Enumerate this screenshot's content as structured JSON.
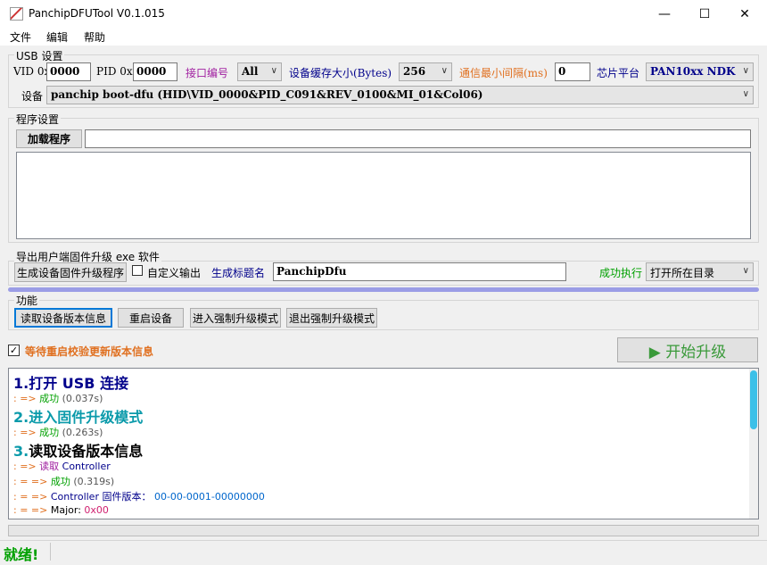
{
  "window": {
    "title": "PanchipDFUTool V0.1.015",
    "minimize": "—",
    "maximize": "☐",
    "close": "✕"
  },
  "menu": [
    "文件",
    "编辑",
    "帮助"
  ],
  "usb": {
    "group_label": "USB 设置",
    "vid_label": "VID 0x",
    "vid_value": "0000",
    "pid_label": "PID 0x",
    "pid_value": "0000",
    "port_label": "接口编号",
    "port_value": "All",
    "buffer_label": "设备缓存大小(Bytes)",
    "buffer_value": "256",
    "interval_label": "通信最小间隔(ms)",
    "interval_value": "0",
    "chip_label": "芯片平台",
    "chip_value": "PAN10xx NDK",
    "device_label": "设备",
    "device_value": "panchip boot-dfu (HID\\VID_0000&PID_C091&REV_0100&MI_01&Col06)"
  },
  "program": {
    "group_label": "程序设置",
    "load_button": "加载程序",
    "path_value": ""
  },
  "export": {
    "group_label": "导出用户端固件升级 exe 软件",
    "generate_button": "生成设备固件升级程序",
    "custom_output_label": "自定义输出",
    "title_name_label": "生成标题名",
    "title_name_value": "PanchipDfu",
    "success_label": "成功执行",
    "success_action": "打开所在目录"
  },
  "functions": {
    "group_label": "功能",
    "buttons": [
      "读取设备版本信息",
      "重启设备",
      "进入强制升级模式",
      "退出强制升级模式"
    ]
  },
  "wait_check_label": "等待重启校验更新版本信息",
  "start_button": "▶ 开始升级",
  "log": {
    "lines": [
      {
        "prefix": "1.",
        "text": "打开 USB 连接"
      },
      {
        "prefix": ": =>",
        "text": "成功",
        "extra": "(0.037s)"
      },
      {
        "prefix": "2.",
        "text": "进入固件升级模式"
      },
      {
        "prefix": ": =>",
        "text": "成功",
        "extra": "(0.263s)"
      },
      {
        "prefix": "3.",
        "text": "读取设备版本信息"
      },
      {
        "prefix": ": =>",
        "text": "读取",
        "extra": "Controller"
      },
      {
        "prefix": ": = =>",
        "text": "成功",
        "extra": "(0.319s)"
      },
      {
        "prefix": ": = =>",
        "text": "Controller 固件版本：",
        "extra": "00-00-0001-00000000"
      },
      {
        "prefix": ": = =>",
        "text": "Major:",
        "extra": "0x00"
      }
    ]
  },
  "status": "就绪!",
  "colors": {
    "accent_bar": "#9b9de6",
    "blue_text": "#00008b",
    "orange_text": "#e07020",
    "green_text": "#00a000",
    "purple_text": "#a020a0"
  }
}
